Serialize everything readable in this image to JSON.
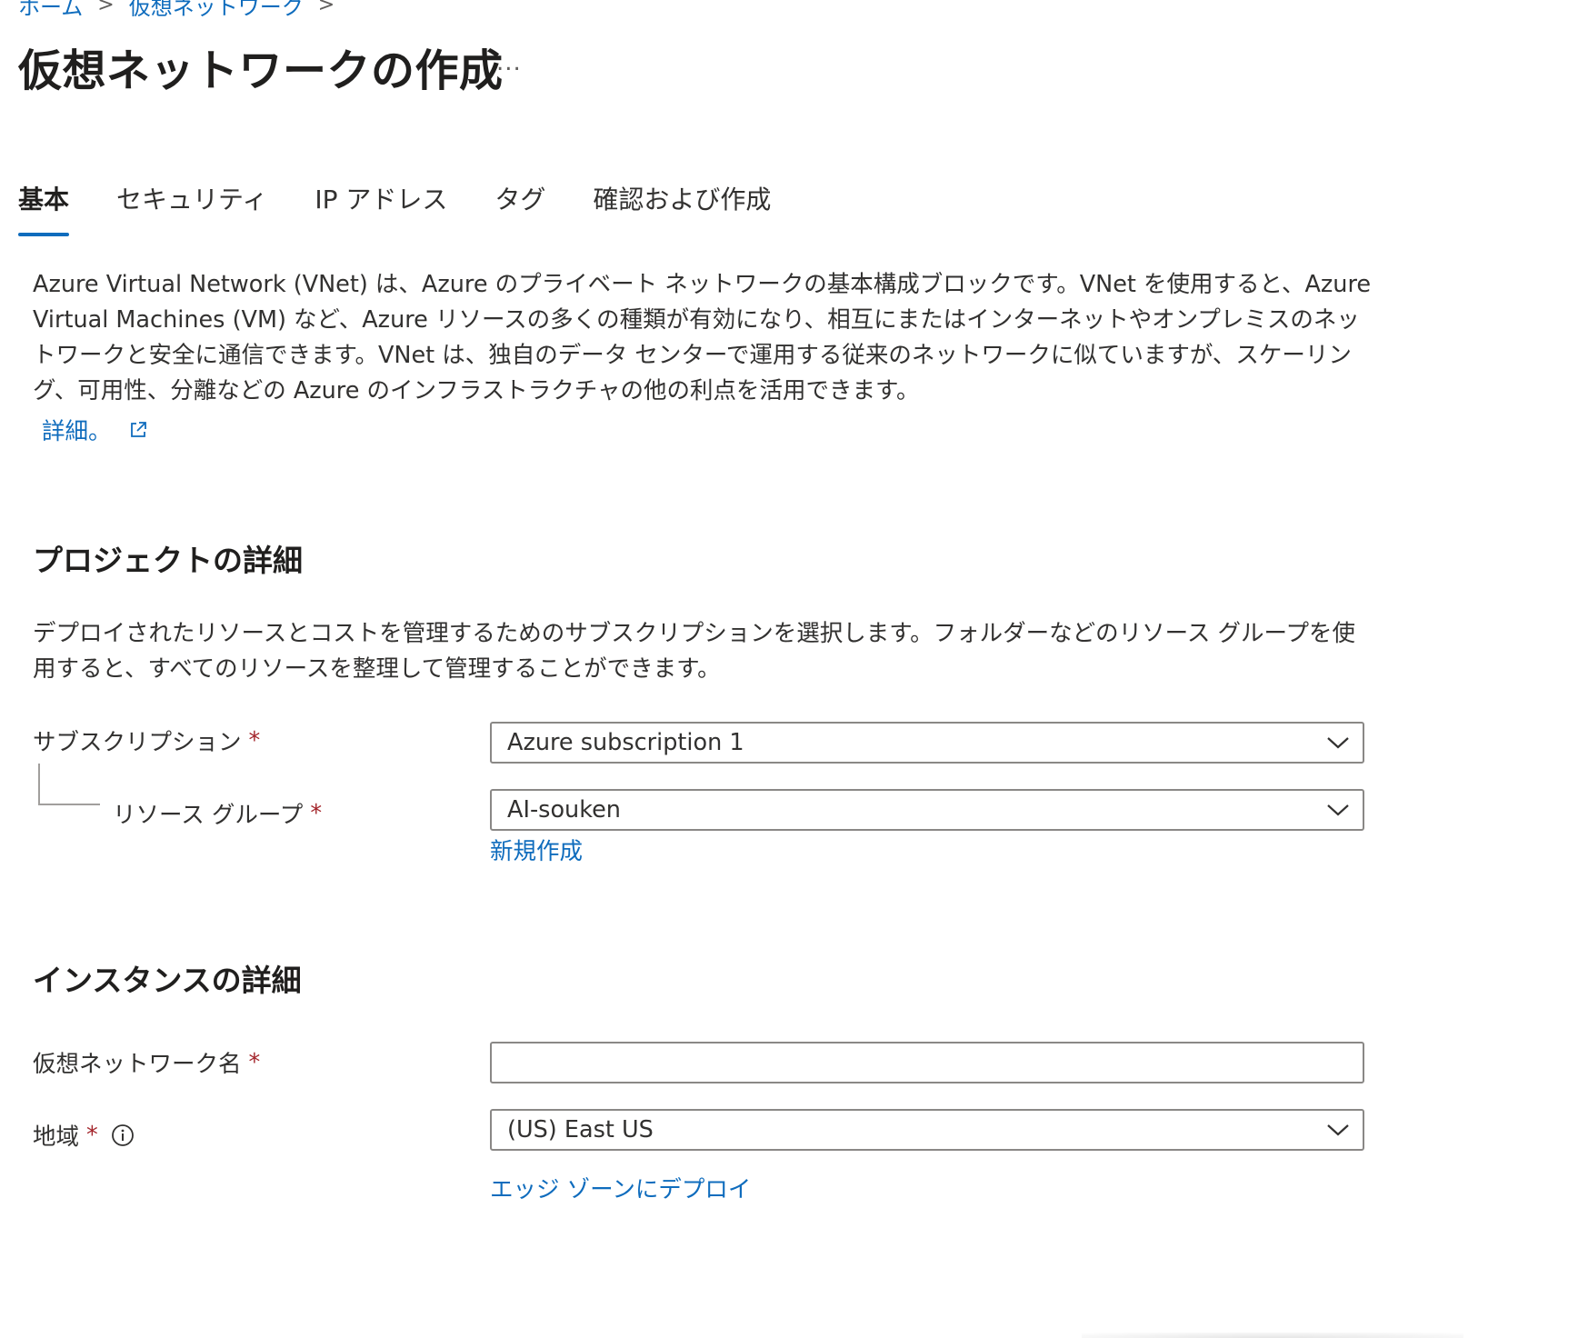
{
  "breadcrumb": {
    "items": [
      "ホーム",
      "仮想ネットワーク"
    ],
    "separator": ">"
  },
  "page": {
    "title": "仮想ネットワークの作成",
    "more_label": "..."
  },
  "tabs": [
    {
      "label": "基本",
      "active": true
    },
    {
      "label": "セキュリティ",
      "active": false
    },
    {
      "label": "IP アドレス",
      "active": false
    },
    {
      "label": "タグ",
      "active": false
    },
    {
      "label": "確認および作成",
      "active": false
    }
  ],
  "intro": {
    "text": "Azure Virtual Network (VNet) は、Azure のプライベート ネットワークの基本構成ブロックです。VNet を使用すると、Azure Virtual Machines (VM) など、Azure リソースの多くの種類が有効になり、相互にまたはインターネットやオンプレミスのネットワークと安全に通信できます。VNet は、独自のデータ センターで運用する従来のネットワークに似ていますが、スケーリング、可用性、分離などの Azure のインフラストラクチャの他の利点を活用できます。",
    "learn_more": "詳細。"
  },
  "project": {
    "title": "プロジェクトの詳細",
    "description": "デプロイされたリソースとコストを管理するためのサブスクリプションを選択します。フォルダーなどのリソース グループを使用すると、すべてのリソースを整理して管理することができます。",
    "subscription_label": "サブスクリプション",
    "subscription_value": "Azure subscription 1",
    "resource_group_label": "リソース グループ",
    "resource_group_value": "AI-souken",
    "create_new": "新規作成",
    "required_mark": "*"
  },
  "instance": {
    "title": "インスタンスの詳細",
    "vnet_name_label": "仮想ネットワーク名",
    "vnet_name_value": "",
    "region_label": "地域",
    "region_value": "(US) East US",
    "edge_zone_link": "エッジ ゾーンにデプロイ",
    "required_mark": "*"
  },
  "colors": {
    "link": "#0f6cbd",
    "required": "#a4262c",
    "text": "#323130",
    "border": "#8a8886"
  }
}
